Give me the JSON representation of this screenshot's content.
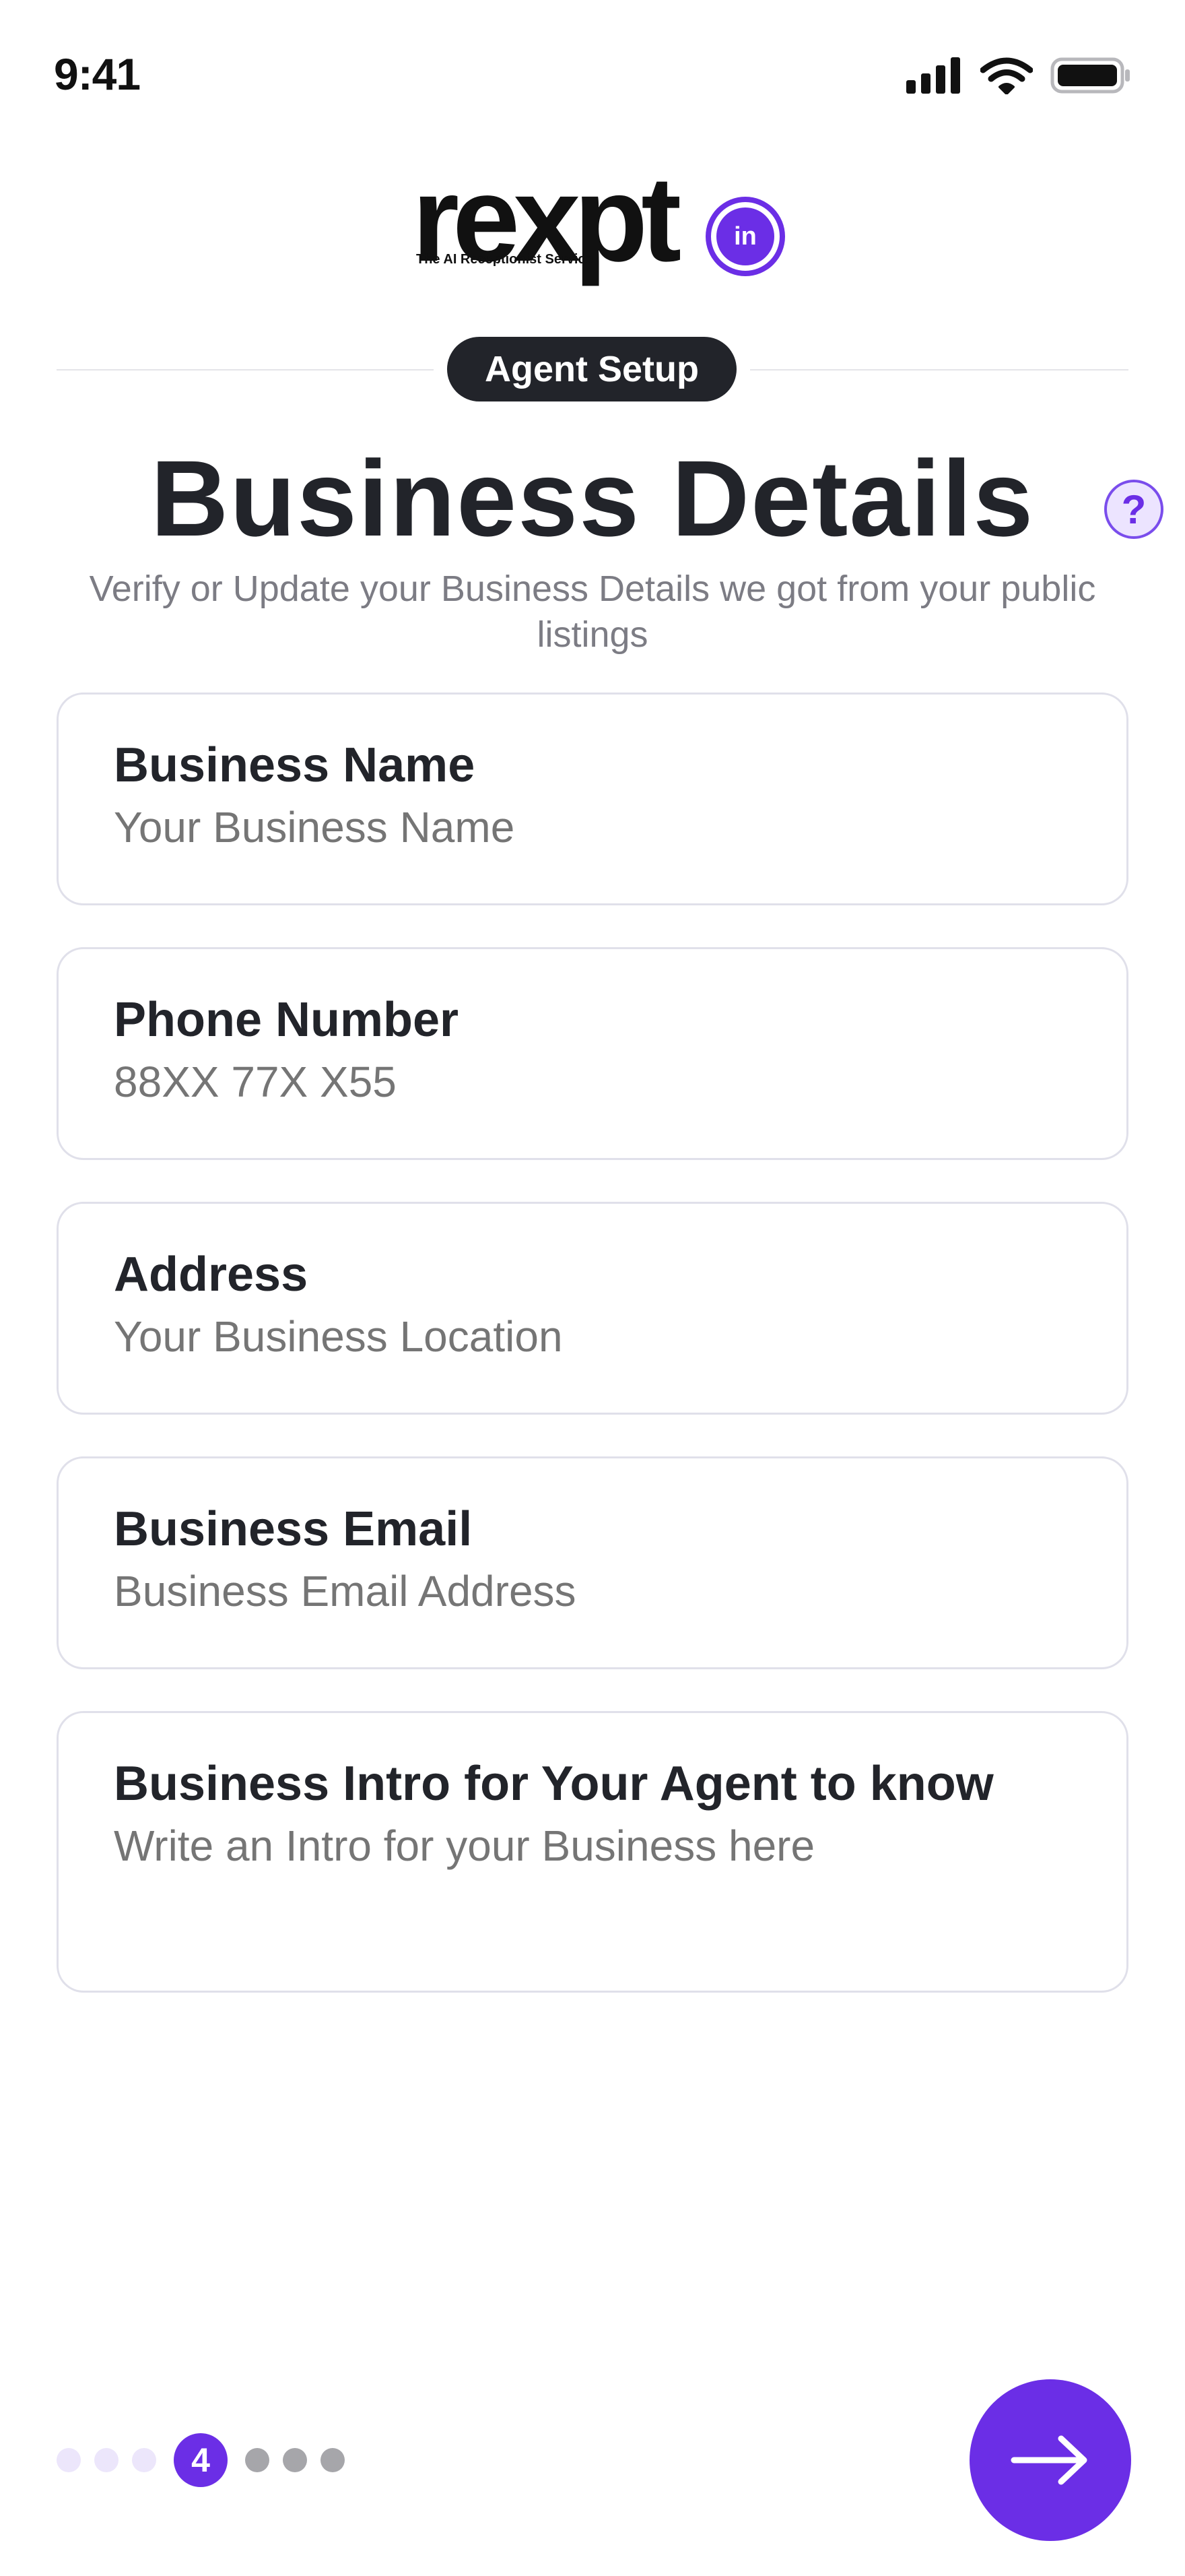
{
  "status_bar": {
    "time": "9:41"
  },
  "brand": {
    "logo_text": "rexpt",
    "tagline": "The AI Receptionist Service",
    "badge_text": "in"
  },
  "header": {
    "step_pill": "Agent Setup",
    "title": "Business Details",
    "help_glyph": "?",
    "subtitle": "Verify or Update your Business Details we got from your public listings"
  },
  "form": {
    "fields": [
      {
        "label": "Business Name",
        "placeholder": "Your Business Name",
        "value": ""
      },
      {
        "label": "Phone Number",
        "placeholder": "88XX 77X X55",
        "value": ""
      },
      {
        "label": "Address",
        "placeholder": "Your Business Location",
        "value": ""
      },
      {
        "label": "Business Email",
        "placeholder": "Business Email Address",
        "value": ""
      },
      {
        "label": "Business Intro for Your Agent to know",
        "placeholder": "Write an Intro for your Business here",
        "value": ""
      }
    ]
  },
  "pagination": {
    "current_step": "4",
    "total_steps": 7
  },
  "colors": {
    "accent": "#6b2ee6",
    "pill_bg": "#22242a",
    "placeholder": "#9aa6c8",
    "border": "#e0e0ea",
    "dot_done": "#ece6fb",
    "dot_todo": "#a6a6aa"
  },
  "icons": {
    "signal": "signal-bars-icon",
    "wifi": "wifi-icon",
    "battery": "battery-icon",
    "help": "question-mark-icon",
    "next": "arrow-right-icon"
  }
}
